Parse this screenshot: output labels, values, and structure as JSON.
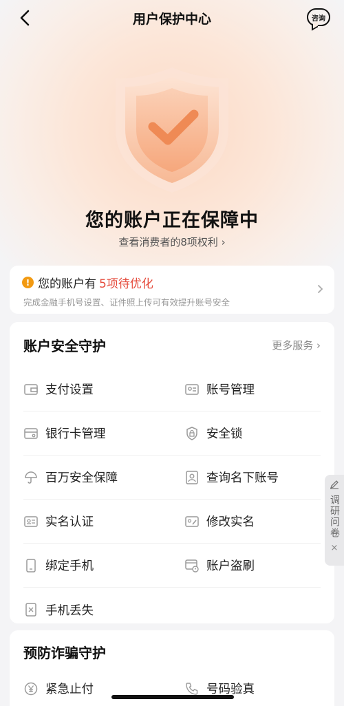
{
  "nav": {
    "title": "用户保护中心",
    "consult_label": "咨询"
  },
  "hero": {
    "title": "您的账户正在保障中",
    "link": "查看消费者的8项权利 ›"
  },
  "optimize": {
    "prefix": "您的账户有",
    "highlight": "5项待优化",
    "subtitle": "完成金融手机号设置、证件照上传可有效提升账号安全"
  },
  "account_security": {
    "title": "账户安全守护",
    "more": "更多服务 ›",
    "items": [
      {
        "label": "支付设置",
        "icon": "wallet-icon"
      },
      {
        "label": "账号管理",
        "icon": "id-card-icon"
      },
      {
        "label": "银行卡管理",
        "icon": "bank-card-icon"
      },
      {
        "label": "安全锁",
        "icon": "shield-lock-icon"
      },
      {
        "label": "百万安全保障",
        "icon": "umbrella-icon"
      },
      {
        "label": "查询名下账号",
        "icon": "person-icon"
      },
      {
        "label": "实名认证",
        "icon": "id-card-icon"
      },
      {
        "label": "修改实名",
        "icon": "id-edit-icon"
      },
      {
        "label": "绑定手机",
        "icon": "phone-icon"
      },
      {
        "label": "账户盗刷",
        "icon": "alert-card-icon"
      },
      {
        "label": "手机丢失",
        "icon": "phone-lost-icon"
      }
    ]
  },
  "fraud": {
    "title": "预防诈骗守护",
    "items": [
      {
        "label": "紧急止付",
        "icon": "yen-stop-icon"
      },
      {
        "label": "号码验真",
        "icon": "phone-verify-icon"
      }
    ]
  },
  "side_tab": {
    "label": "调研问卷",
    "close": "×"
  },
  "colors": {
    "accent": "#e54b3c",
    "warning": "#f29a12",
    "shield": "#f6a77c"
  }
}
